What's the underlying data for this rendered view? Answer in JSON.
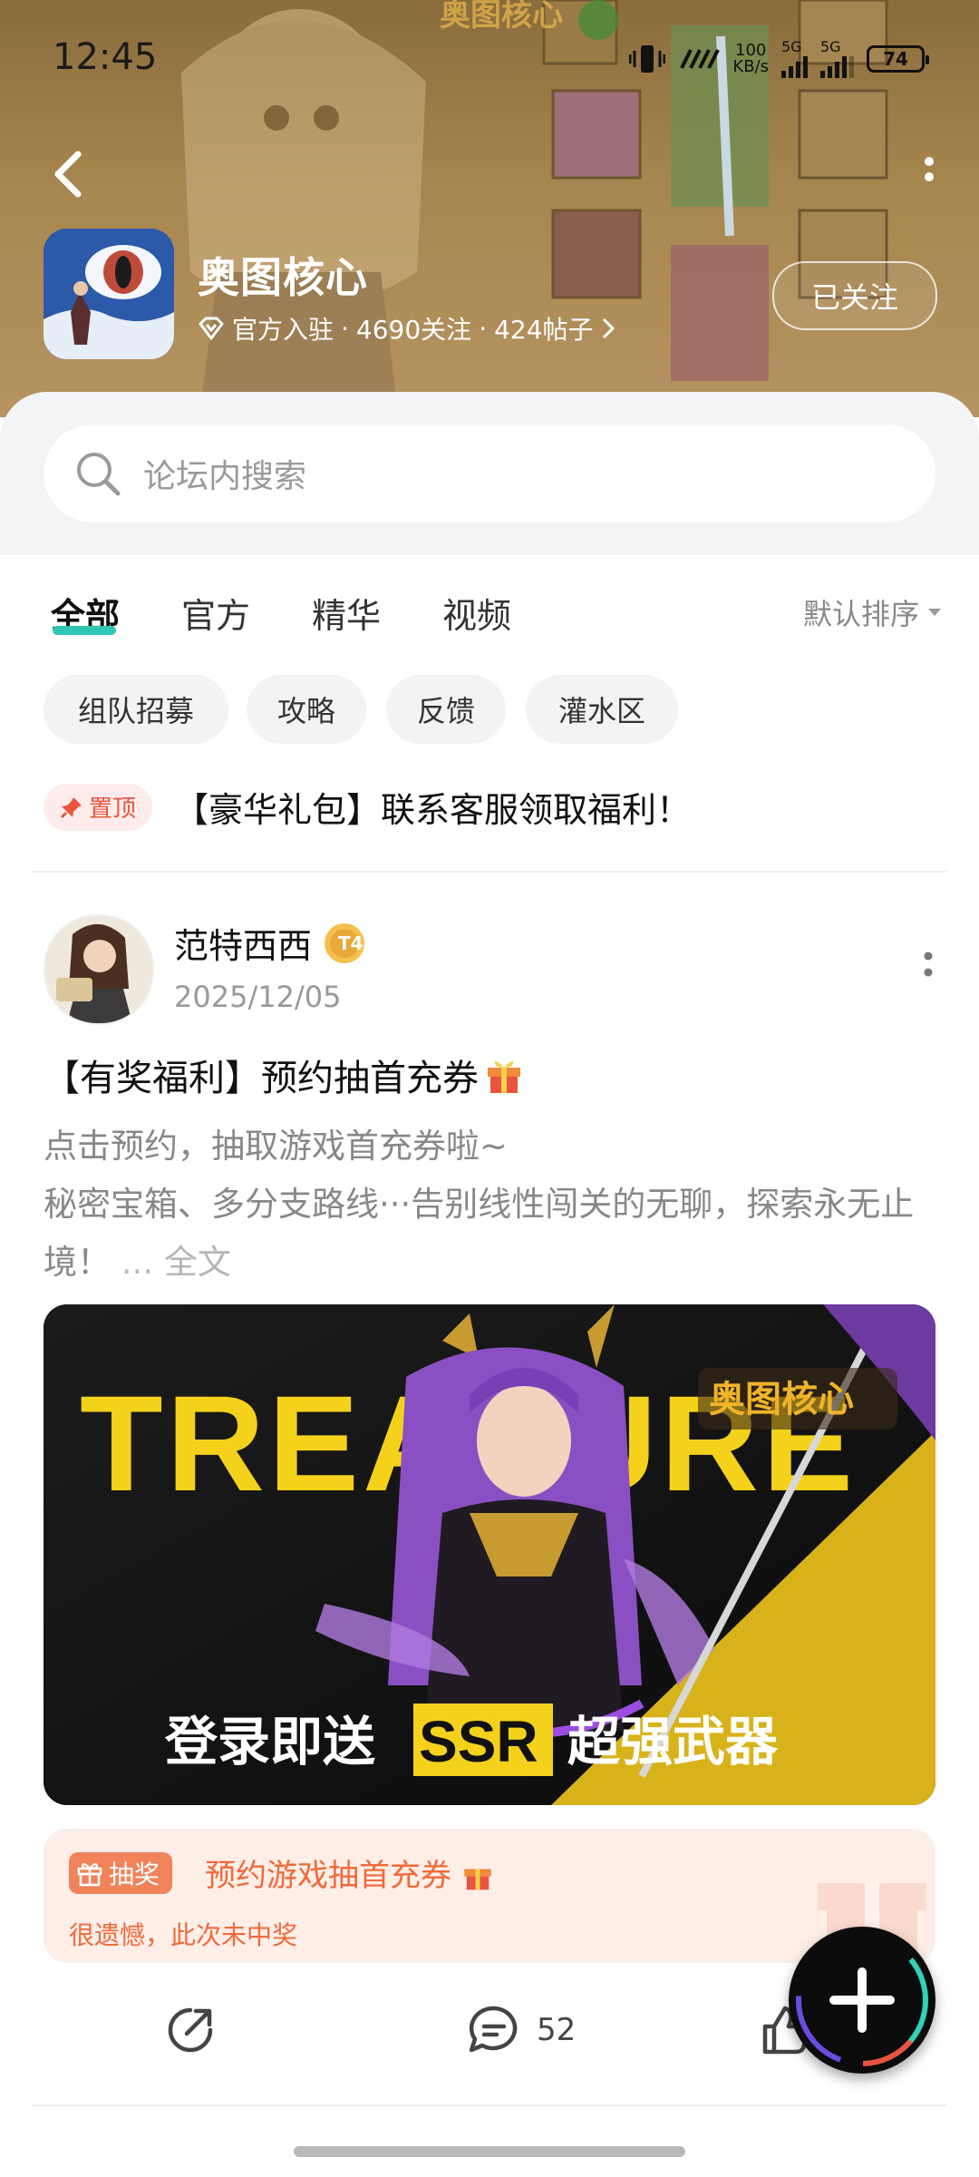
{
  "status_bar": {
    "time": "12:45",
    "net_speed_value": "100",
    "net_speed_unit": "KB/s",
    "network_1": "5G",
    "network_2": "5G",
    "battery": "74"
  },
  "header": {
    "forum_name": "奥图核心",
    "official_label": "官方入驻",
    "followers": "4690关注",
    "posts": "424帖子",
    "separator": "·",
    "follow_button": "已关注",
    "art_game_logo_text": "奥图核心"
  },
  "search": {
    "placeholder": "论坛内搜索"
  },
  "tabs": {
    "items": [
      {
        "label": "全部",
        "active": true
      },
      {
        "label": "官方",
        "active": false
      },
      {
        "label": "精华",
        "active": false
      },
      {
        "label": "视频",
        "active": false
      }
    ],
    "sort_label": "默认排序"
  },
  "chips": [
    "组队招募",
    "攻略",
    "反馈",
    "灌水区"
  ],
  "pinned": {
    "badge": "置顶",
    "title": "【豪华礼包】联系客服领取福利！"
  },
  "post": {
    "author": "范特西西",
    "level_badge": "T4",
    "date": "2025/12/05",
    "title": "【有奖福利】预约抽首充券",
    "body_line1": "点击预约，抽取游戏首充券啦~",
    "body_line2": "秘密宝箱、多分支路线···告别线性闯关的无聊，探索永无止境！",
    "ellipsis": "...",
    "read_more": "全文",
    "banner": {
      "logo_text": "奥图核心",
      "big_text": "TREASURE",
      "caption_left": "登录即送",
      "caption_highlight": "SSR",
      "caption_right": "超强武器"
    },
    "lottery": {
      "badge": "抽奖",
      "title": "预约游戏抽首充券",
      "result": "很遗憾，此次未中奖"
    },
    "comments_count": "52"
  },
  "colors": {
    "accent": "#2fc6b2",
    "pin_red": "#e8543f",
    "lottery_orange": "#ef6a3a",
    "banner_yellow": "#f4d21c"
  },
  "icons": [
    "back-arrow-icon",
    "more-vertical-icon",
    "verified-diamond-icon",
    "chevron-right-icon",
    "search-icon",
    "caret-down-icon",
    "pin-icon",
    "gift-icon",
    "share-icon",
    "comment-icon",
    "like-icon",
    "plus-icon"
  ]
}
